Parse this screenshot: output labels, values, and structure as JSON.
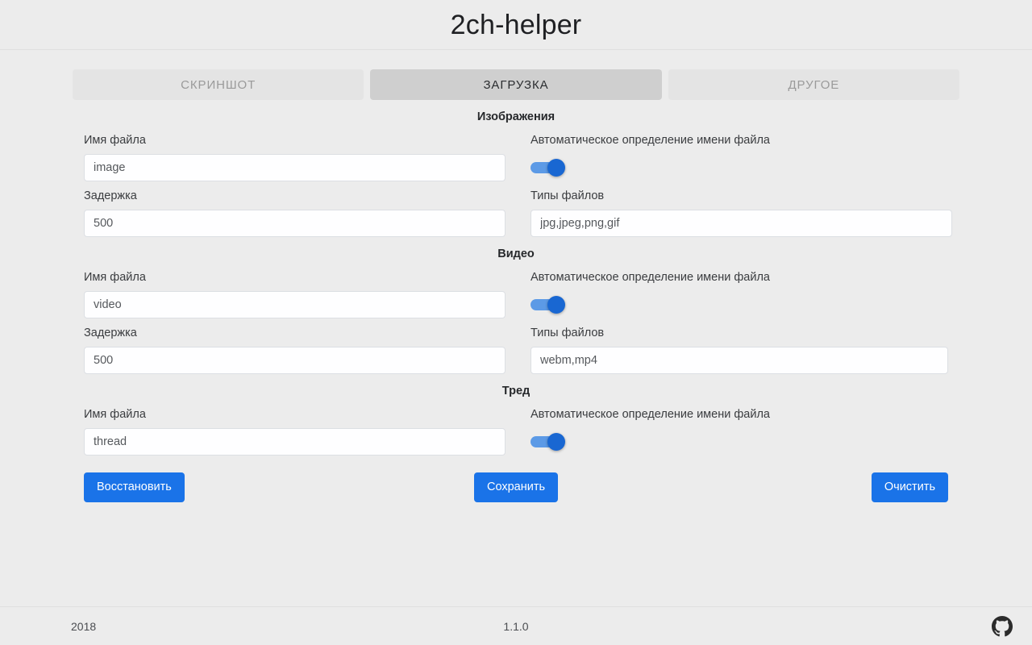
{
  "header": {
    "title": "2ch-helper"
  },
  "tabs": [
    {
      "label": "СКРИНШОТ",
      "active": false,
      "name": "tab-screenshot"
    },
    {
      "label": "ЗАГРУЗКА",
      "active": true,
      "name": "tab-download"
    },
    {
      "label": "ДРУГОЕ",
      "active": false,
      "name": "tab-other"
    }
  ],
  "sections": {
    "images": {
      "title": "Изображения",
      "filename_label": "Имя файла",
      "filename_value": "image",
      "auto_label": "Автоматическое определение имени файла",
      "auto_enabled": true,
      "delay_label": "Задержка",
      "delay_value": "500",
      "filetypes_label": "Типы файлов",
      "filetypes_value": "jpg,jpeg,png,gif"
    },
    "video": {
      "title": "Видео",
      "filename_label": "Имя файла",
      "filename_value": "video",
      "auto_label": "Автоматическое определение имени файла",
      "auto_enabled": true,
      "delay_label": "Задержка",
      "delay_value": "500",
      "filetypes_label": "Типы файлов",
      "filetypes_value": "webm,mp4"
    },
    "thread": {
      "title": "Тред",
      "filename_label": "Имя файла",
      "filename_value": "thread",
      "auto_label": "Автоматическое определение имени файла",
      "auto_enabled": true
    }
  },
  "actions": {
    "restore_label": "Восстановить",
    "save_label": "Сохранить",
    "clear_label": "Очистить"
  },
  "footer": {
    "year": "2018",
    "version": "1.1.0",
    "github_icon": "github-icon"
  },
  "colors": {
    "accent": "#1a73e8",
    "toggle_track": "#5c9ae6",
    "toggle_thumb": "#1967d2",
    "background": "#ececec",
    "tab_active_bg": "#cfcfcf",
    "tab_inactive_bg": "#e4e4e4"
  }
}
